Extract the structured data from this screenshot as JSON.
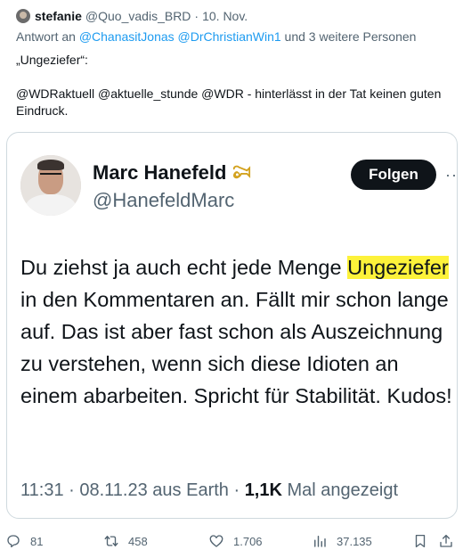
{
  "outer": {
    "name": "stefanie",
    "handle": "@Quo_vadis_BRD",
    "separator": "·",
    "date": "10. Nov.",
    "reply_prefix": "Antwort an ",
    "reply_mentions": "@ChanasitJonas @DrChristianWin1",
    "reply_suffix": " und 3 weitere Personen",
    "text_line1": "„Ungeziefer“:",
    "text_line2": "@WDRaktuell @aktuelle_stunde @WDR - hinterlässt in der Tat keinen guten Eindruck."
  },
  "card": {
    "name": "Marc Hanefeld",
    "handle": "@HanefeldMarc",
    "follow_label": "Folgen",
    "more": "···",
    "quote_before": "Du ziehst ja auch echt jede Menge ",
    "quote_highlight": "Ungeziefer",
    "quote_after": " in den Kommentaren an. Fällt mir schon lange auf. Das ist aber fast schon als Auszeichnung zu verstehen, wenn sich diese Idioten an einem abarbeiten. Spricht für Stabilität. Kudos!",
    "time": "11:31",
    "date": "08.11.23",
    "source": "aus Earth",
    "views_count": "1,1K",
    "views_label": "Mal angezeigt",
    "highlight_color": "#fdf23a"
  },
  "actions": {
    "replies": "81",
    "retweets": "458",
    "likes": "1.706",
    "views": "37.135"
  },
  "colors": {
    "text": "#0f1419",
    "muted": "#536471",
    "link": "#1d9bf0",
    "border": "#cfd9de"
  }
}
